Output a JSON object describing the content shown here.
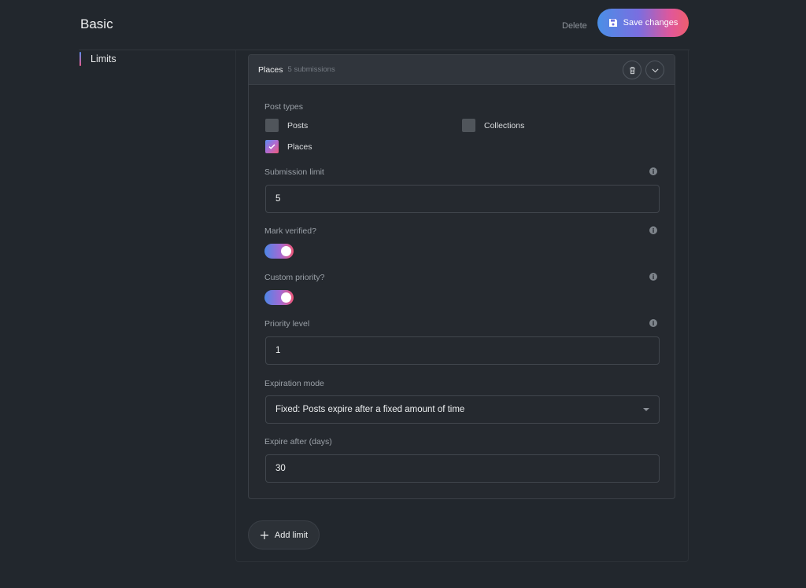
{
  "header": {
    "title": "Basic",
    "delete_label": "Delete",
    "save_label": "Save changes"
  },
  "sidebar": {
    "items": [
      {
        "label": "Limits",
        "active": true
      }
    ]
  },
  "limit_card": {
    "title": "Places",
    "count": "5 submissions",
    "post_types": {
      "label": "Post types",
      "options": [
        {
          "label": "Posts",
          "checked": false
        },
        {
          "label": "Collections",
          "checked": false
        },
        {
          "label": "Places",
          "checked": true
        }
      ]
    },
    "submission_limit": {
      "label": "Submission limit",
      "value": "5"
    },
    "mark_verified": {
      "label": "Mark verified?",
      "on": true
    },
    "custom_priority": {
      "label": "Custom priority?",
      "on": true
    },
    "priority_level": {
      "label": "Priority level",
      "value": "1"
    },
    "expiration_mode": {
      "label": "Expiration mode",
      "selected": "Fixed: Posts expire after a fixed amount of time"
    },
    "expire_after": {
      "label": "Expire after (days)",
      "value": "30"
    }
  },
  "actions": {
    "add_limit_label": "Add limit"
  },
  "colors": {
    "background": "#22272d",
    "accent_gradient_start": "#4a8fe6",
    "accent_gradient_end": "#ef5e6e"
  }
}
